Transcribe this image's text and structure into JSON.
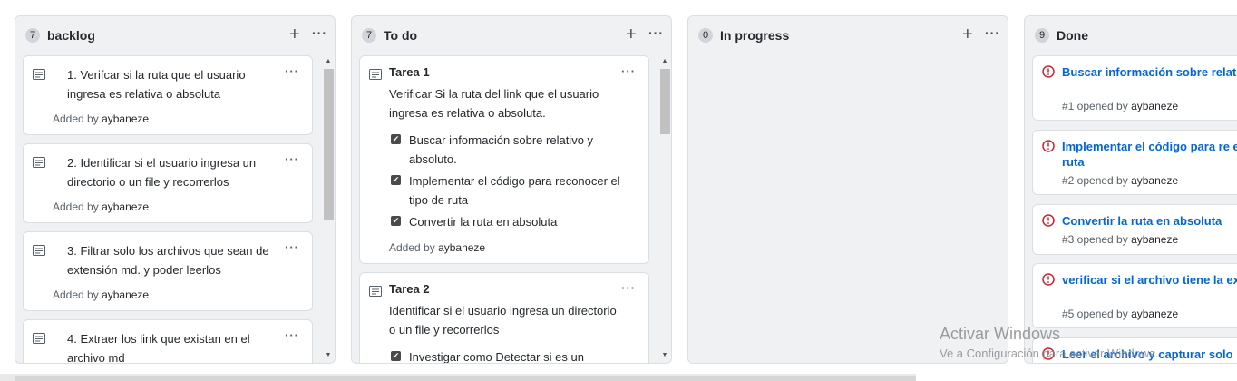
{
  "columns": [
    {
      "count": "7",
      "title": "backlog",
      "cards": [
        {
          "text": "1. Verifcar si la ruta que el usuario ingresa es relativa o absoluta",
          "added_prefix": "Added by",
          "author": "aybaneze"
        },
        {
          "text": "2. Identificar si el usuario ingresa un directorio o un file y recorrerlos",
          "added_prefix": "Added by",
          "author": "aybaneze"
        },
        {
          "text": "3. Filtrar solo los archivos que sean de extensión md. y poder leerlos",
          "added_prefix": "Added by",
          "author": "aybaneze"
        },
        {
          "text": "4. Extraer los link que existan en el archivo md"
        }
      ]
    },
    {
      "count": "7",
      "title": "To do",
      "cards": [
        {
          "title": "Tarea 1",
          "desc": "Verificar Si la ruta del link que el usuario ingresa es relativa o absoluta.",
          "checklist": [
            "Buscar información sobre relativo y absoluto.",
            "Implementar el código para reconocer el tipo de ruta",
            "Convertir la ruta en absoluta"
          ],
          "added_prefix": "Added by",
          "author": "aybaneze"
        },
        {
          "title": "Tarea 2",
          "desc": "Identificar si el usuario ingresa un directorio o un file y recorrerlos",
          "checklist": [
            "Investigar como Detectar si es un"
          ]
        }
      ]
    },
    {
      "count": "0",
      "title": "In progress",
      "cards": []
    },
    {
      "count": "9",
      "title": "Done",
      "cards": [
        {
          "title": "Buscar información sobre relat absoluto.",
          "meta_prefix": "#1 opened by",
          "author": "aybaneze"
        },
        {
          "title": "Implementar el código para re el tipo de ruta",
          "meta_prefix": "#2 opened by",
          "author": "aybaneze"
        },
        {
          "title": "Convertir la ruta en absoluta",
          "meta_prefix": "#3 opened by",
          "author": "aybaneze"
        },
        {
          "title": "verificar si el archivo tiene la ex md",
          "meta_prefix": "#5 opened by",
          "author": "aybaneze"
        },
        {
          "title": "Leer el archivo y capturar solo"
        }
      ]
    }
  ],
  "icons": {
    "plus": "+",
    "more": "···",
    "note": "note-icon",
    "issue_closed": "issue-closed-icon",
    "check": "✔",
    "scroll_up": "▲",
    "scroll_down": "▼"
  },
  "watermark": {
    "title": "Activar Windows",
    "subtitle": "Ve a Configuración para activar Windows."
  },
  "colors": {
    "link": "#0366d6",
    "issue_closed": "#cb2431",
    "column_bg": "#eff1f3"
  }
}
